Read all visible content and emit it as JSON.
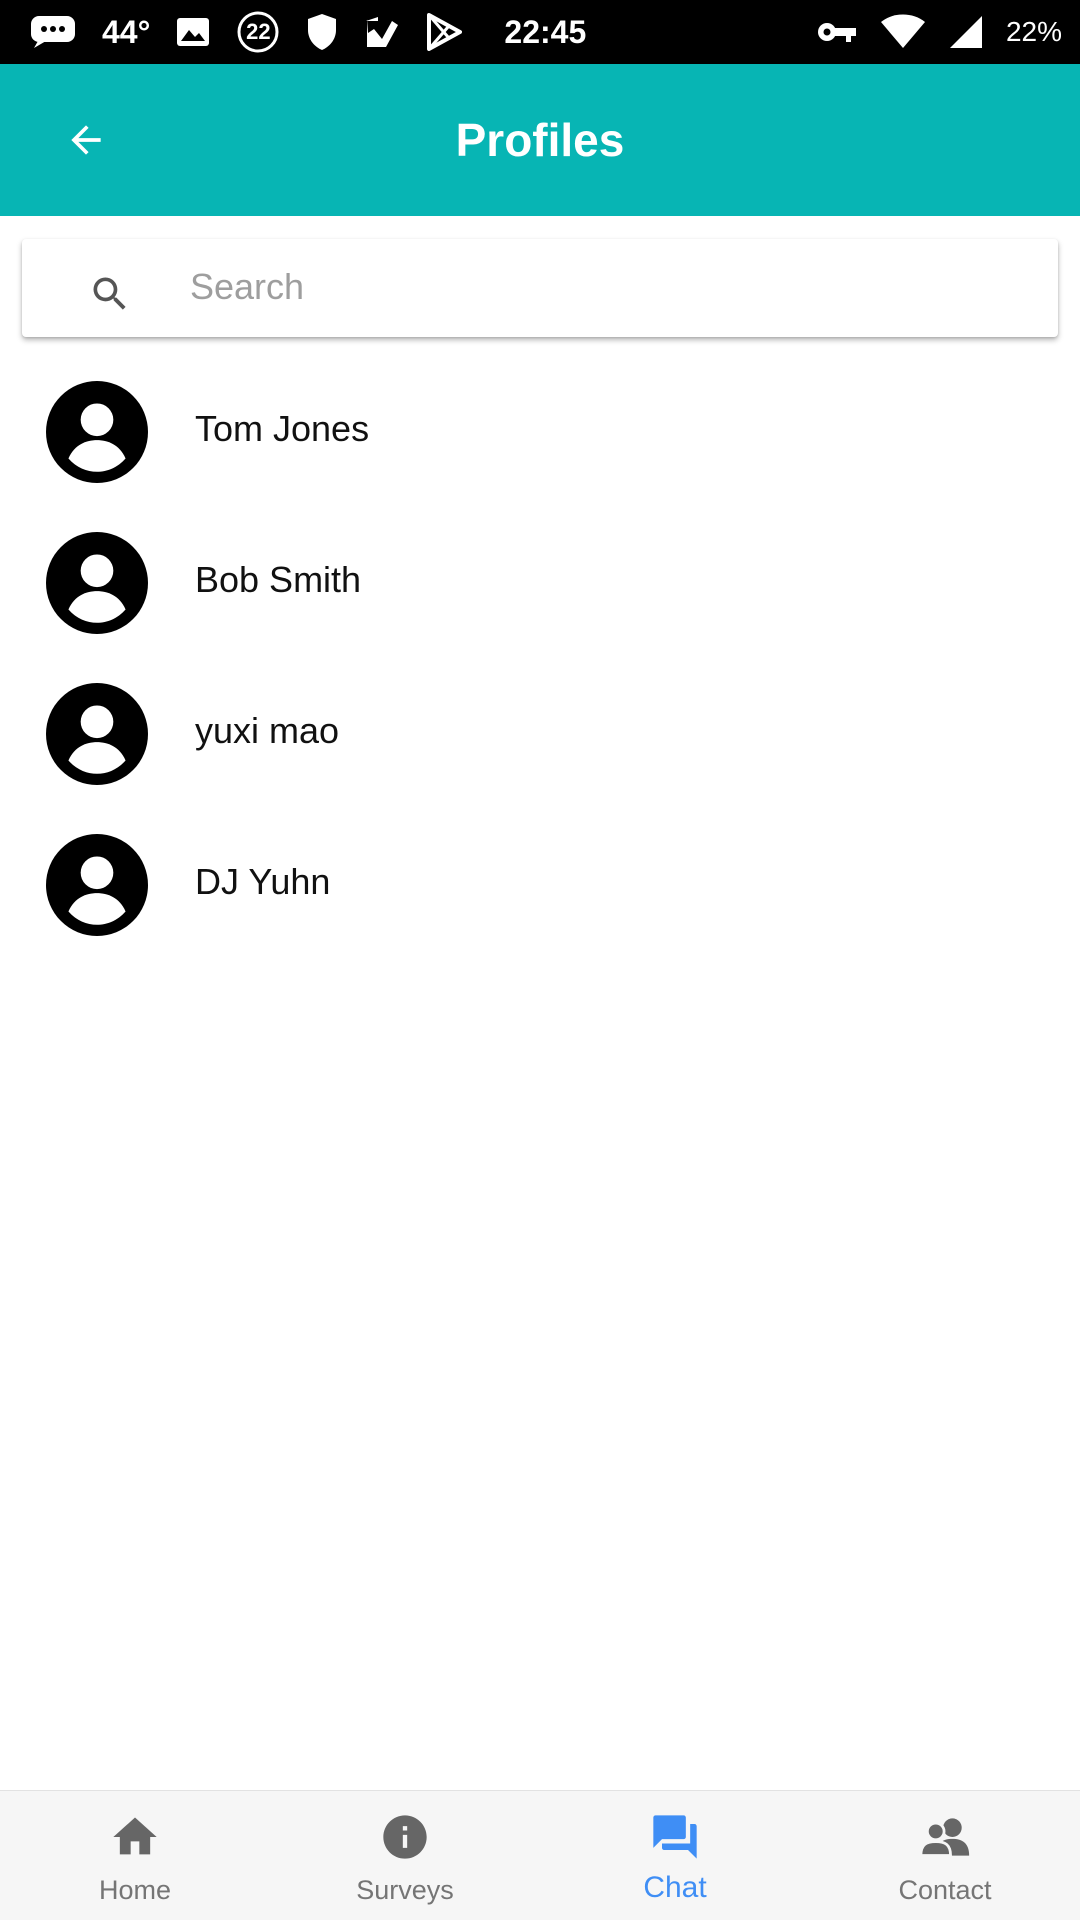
{
  "status_bar": {
    "temperature": "44°",
    "badge_number": "22",
    "time": "22:45",
    "battery": "22%"
  },
  "app_bar": {
    "title": "Profiles",
    "color": "#07B5B4"
  },
  "search": {
    "placeholder": "Search",
    "value": ""
  },
  "profiles": [
    {
      "name": "Tom Jones"
    },
    {
      "name": "Bob Smith"
    },
    {
      "name": "yuxi mao"
    },
    {
      "name": "DJ Yuhn"
    }
  ],
  "bottom_nav": {
    "active_color": "#3F8EF5",
    "items": [
      {
        "label": "Home",
        "icon": "home-icon"
      },
      {
        "label": "Surveys",
        "icon": "info-icon"
      },
      {
        "label": "Chat",
        "icon": "chat-icon",
        "active": true
      },
      {
        "label": "Contact",
        "icon": "contacts-icon"
      }
    ]
  }
}
